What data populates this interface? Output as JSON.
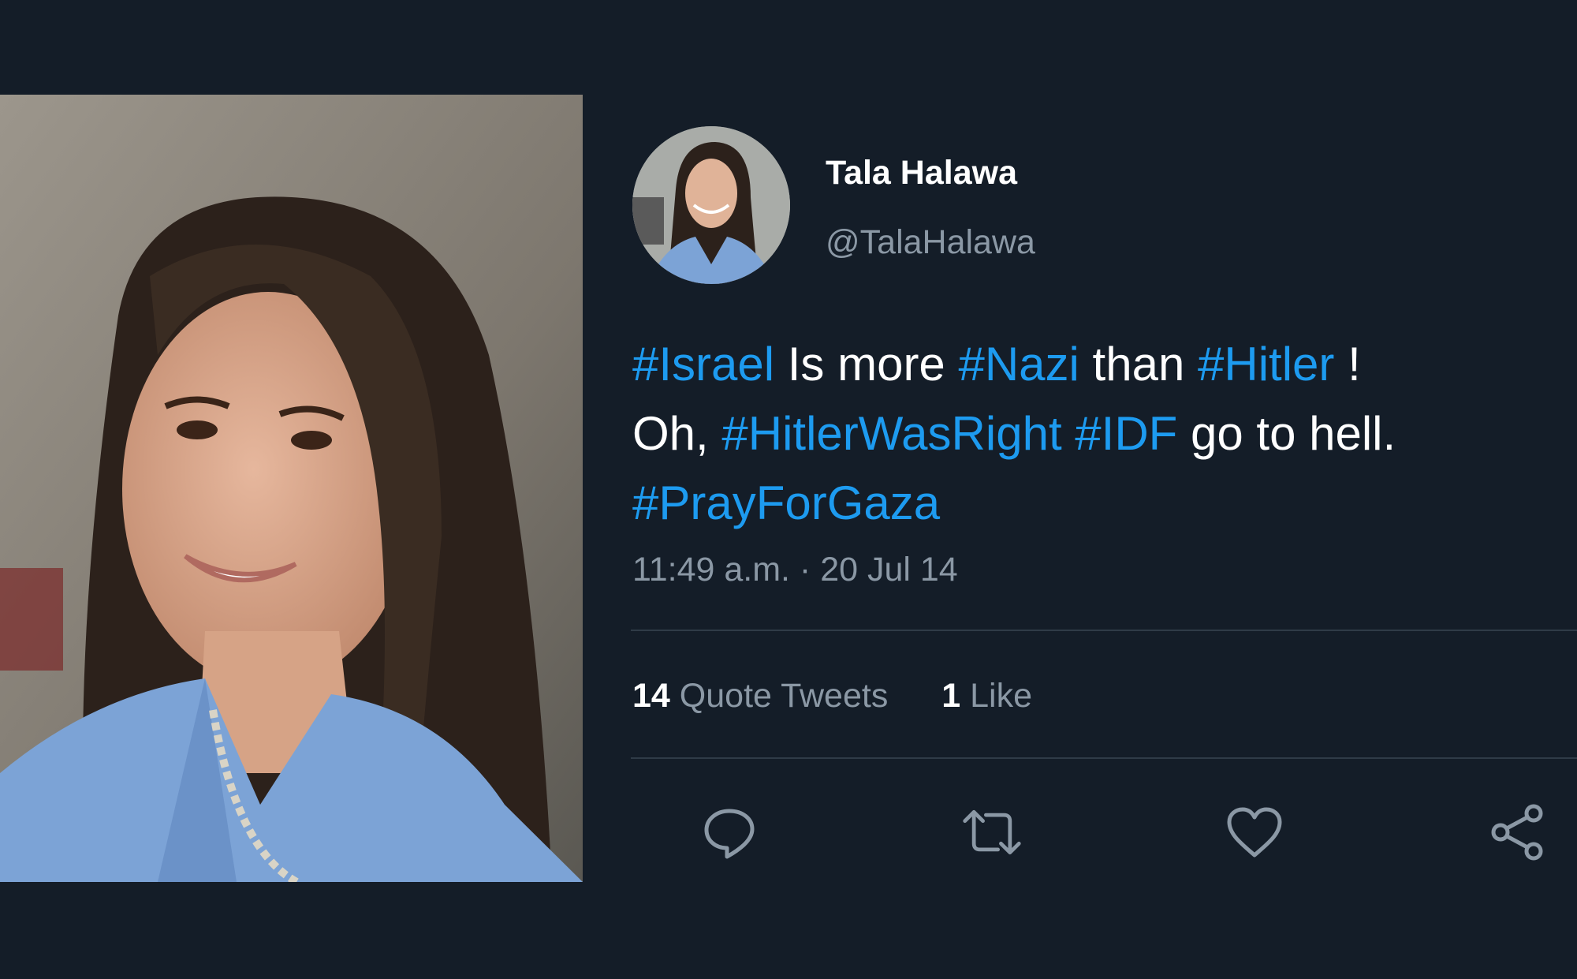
{
  "tweet": {
    "display_name": "Tala Halawa",
    "handle": "@TalaHalawa",
    "text_line1": {
      "tag1": "#Israel",
      "mid1": " Is more ",
      "tag2": "#Nazi",
      "mid2": " than ",
      "tag3": "#Hitler",
      "end": " !"
    },
    "text_line2": {
      "start": "Oh, ",
      "tag1": "#HitlerWasRight",
      "mid1": " ",
      "tag2": "#IDF",
      "end": " go to hell."
    },
    "text_line3": {
      "tag1": "#PrayForGaza"
    },
    "timestamp": "11:49 a.m. · 20 Jul 14",
    "quote_tweets_count": "14",
    "quote_tweets_label": "Quote Tweets",
    "likes_count": "1",
    "likes_label": "Like"
  },
  "icons": {
    "reply": "reply-icon",
    "retweet": "retweet-icon",
    "like": "heart-icon",
    "share": "share-icon"
  },
  "colors": {
    "background": "#141d28",
    "hashtag": "#1d9bf0",
    "secondary_text": "#8b98a5",
    "primary_text": "#ffffff"
  }
}
